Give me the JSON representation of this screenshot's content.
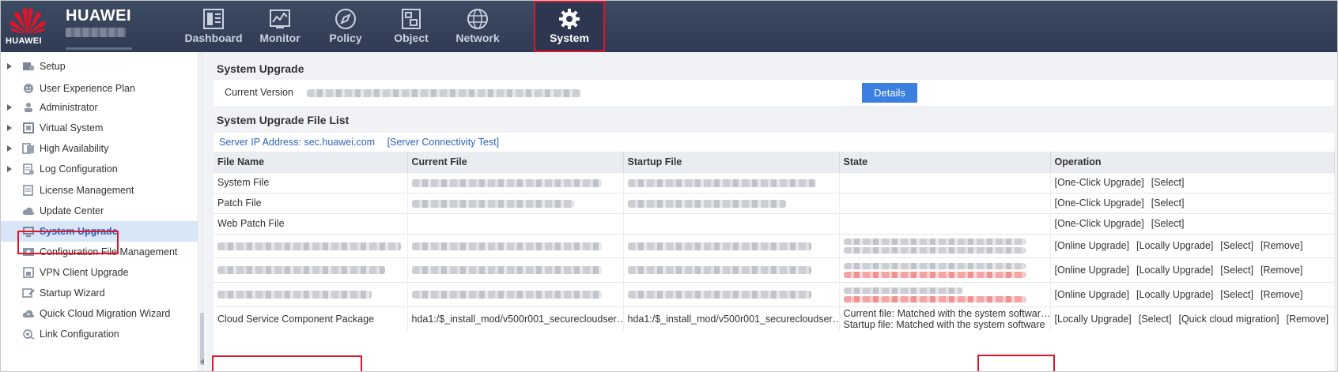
{
  "brand": {
    "logo_text": "HUAWEI",
    "name": "HUAWEI"
  },
  "nav": [
    {
      "label": "Dashboard",
      "icon": "dashboard-icon"
    },
    {
      "label": "Monitor",
      "icon": "monitor-icon"
    },
    {
      "label": "Policy",
      "icon": "policy-icon"
    },
    {
      "label": "Object",
      "icon": "object-icon"
    },
    {
      "label": "Network",
      "icon": "network-icon"
    },
    {
      "label": "System",
      "icon": "gear-icon",
      "active": true
    }
  ],
  "sidebar": {
    "items": [
      {
        "label": "Setup",
        "icon": "setup-icon",
        "expandable": true
      },
      {
        "label": "User Experience Plan",
        "icon": "smile-icon"
      },
      {
        "label": "Administrator",
        "icon": "user-icon",
        "expandable": true
      },
      {
        "label": "Virtual System",
        "icon": "virtual-system-icon",
        "expandable": true
      },
      {
        "label": "High Availability",
        "icon": "ha-icon",
        "expandable": true
      },
      {
        "label": "Log Configuration",
        "icon": "log-icon",
        "expandable": true
      },
      {
        "label": "License Management",
        "icon": "license-icon"
      },
      {
        "label": "Update Center",
        "icon": "cloud-icon"
      },
      {
        "label": "System Upgrade",
        "icon": "system-upgrade-icon",
        "selected": true
      },
      {
        "label": "Configuration File Management",
        "icon": "config-file-icon"
      },
      {
        "label": "VPN Client Upgrade",
        "icon": "vpn-icon"
      },
      {
        "label": "Startup Wizard",
        "icon": "wizard-icon"
      },
      {
        "label": "Quick Cloud Migration Wizard",
        "icon": "cloud-migration-icon"
      },
      {
        "label": "Link Configuration",
        "icon": "link-icon"
      }
    ]
  },
  "upgrade": {
    "title": "System Upgrade",
    "current_version_label": "Current Version",
    "details_button": "Details"
  },
  "file_list": {
    "title": "System Upgrade File List",
    "server_ip": "Server IP Address: sec.huawei.com",
    "server_test": "[Server Connectivity Test]",
    "columns": [
      "File Name",
      "Current File",
      "Startup File",
      "State",
      "Operation"
    ],
    "rows": [
      {
        "name": "System File",
        "operations": [
          "[One-Click Upgrade]",
          "[Select]"
        ]
      },
      {
        "name": "Patch File",
        "operations": [
          "[One-Click Upgrade]",
          "[Select]"
        ]
      },
      {
        "name": "Web Patch File",
        "operations": [
          "[One-Click Upgrade]",
          "[Select]"
        ]
      },
      {
        "name": "",
        "operations": [
          "[Online Upgrade]",
          "[Locally Upgrade]",
          "[Select]",
          "[Remove]"
        ]
      },
      {
        "name": "",
        "operations": [
          "[Online Upgrade]",
          "[Locally Upgrade]",
          "[Select]",
          "[Remove]"
        ]
      },
      {
        "name": "",
        "operations": [
          "[Online Upgrade]",
          "[Locally Upgrade]",
          "[Select]",
          "[Remove]"
        ]
      },
      {
        "name": "Cloud Service Component Package",
        "current_file": "hda1:/$_install_mod/v500r001_securecloudser…",
        "startup_file": "hda1:/$_install_mod/v500r001_securecloudser…",
        "state_line1": "Current file: Matched with the system softwar…",
        "state_line2": "Startup file: Matched with the system software",
        "operations": [
          "[Locally Upgrade]",
          "[Select]",
          "[Quick cloud migration]",
          "[Remove]"
        ]
      }
    ]
  },
  "colors": {
    "accent": "#3b7fe0",
    "link": "#2b63c4",
    "highlight": "#e0142a",
    "topbar": "#34415a"
  }
}
